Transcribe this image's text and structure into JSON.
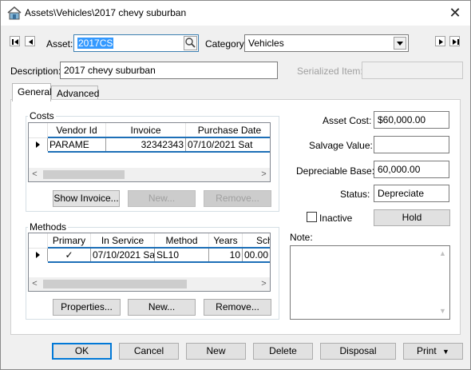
{
  "window": {
    "title": "Assets\\Vehicles\\2017 chevy suburban",
    "icon": "house-icon",
    "close_icon": "close-icon"
  },
  "header": {
    "asset_label": "Asset:",
    "asset_value": "2017CS",
    "category_label": "Category:",
    "category_value": "Vehicles",
    "description_label": "Description:",
    "description_value": "2017 chevy suburban",
    "serialized_label": "Serialized Item:",
    "serialized_value": ""
  },
  "tabs": [
    {
      "label": "General",
      "active": true
    },
    {
      "label": "Advanced",
      "active": false
    }
  ],
  "costs": {
    "group_label": "Costs",
    "columns": [
      "Vendor Id",
      "Invoice",
      "Purchase Date"
    ],
    "rows": [
      {
        "vendor_id": "PARAME",
        "invoice": "32342343",
        "purchase_date": "07/10/2021 Sat"
      }
    ],
    "buttons": {
      "show_invoice": "Show Invoice...",
      "new": "New...",
      "remove": "Remove..."
    }
  },
  "methods": {
    "group_label": "Methods",
    "columns": [
      "Primary",
      "In Service",
      "Method",
      "Years",
      "Sch"
    ],
    "rows": [
      {
        "primary": "✓",
        "in_service": "07/10/2021 Sa",
        "method": "SL10",
        "years": "10",
        "sch": "00.00"
      }
    ],
    "buttons": {
      "properties": "Properties...",
      "new": "New...",
      "remove": "Remove..."
    }
  },
  "right_panel": {
    "asset_cost_label": "Asset Cost:",
    "asset_cost_value": "$60,000.00",
    "salvage_label": "Salvage Value:",
    "salvage_value": "",
    "depreciable_label": "Depreciable Base:",
    "depreciable_value": "60,000.00",
    "status_label": "Status:",
    "status_value": "Depreciate",
    "inactive_label": "Inactive",
    "inactive_checked": false,
    "hold_button": "Hold",
    "note_label": "Note:",
    "note_value": ""
  },
  "footer": {
    "ok": "OK",
    "cancel": "Cancel",
    "new": "New",
    "delete": "Delete",
    "disposal": "Disposal",
    "print": "Print"
  }
}
